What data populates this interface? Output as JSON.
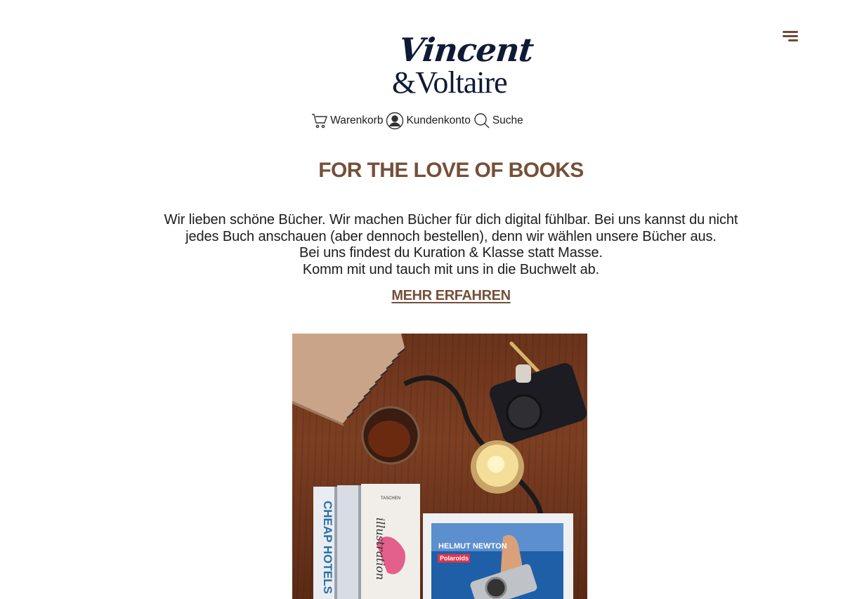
{
  "brand": {
    "logo_line1": "Vincent",
    "logo_line2": "&Voltaire"
  },
  "header": {
    "nav": [
      {
        "label": "Warenkorb",
        "icon": "cart-icon"
      },
      {
        "label": "Kundenkonto",
        "icon": "user-icon"
      },
      {
        "label": "Suche",
        "icon": "search-icon"
      }
    ],
    "menu_icon": "menu-icon"
  },
  "main": {
    "heading": "FOR THE LOVE OF BOOKS",
    "intro_lines": [
      "Wir lieben schöne Bücher. Wir machen Bücher für dich digital fühlbar. Bei uns kannst du nicht",
      "jedes Buch anschauen (aber dennoch bestellen), denn wir wählen unsere Bücher aus.",
      "Bei uns findest du Kuration & Klasse statt Masse.",
      "Komm mit und tauch mit uns in die Buchwelt ab."
    ],
    "more_link": "MEHR ERFAHREN"
  },
  "hero": {
    "book_spine_1": "CHEAP HOTELS",
    "book_spine_3_publisher": "TASCHEN",
    "book_spine_3_title": "illustration",
    "book_cover_author": "HELMUT NEWTON",
    "book_cover_title": "Polaroids"
  },
  "colors": {
    "accent": "#74503a",
    "logo": "#0f1a36",
    "text": "#1c1c1c",
    "background": "#ffffff"
  }
}
